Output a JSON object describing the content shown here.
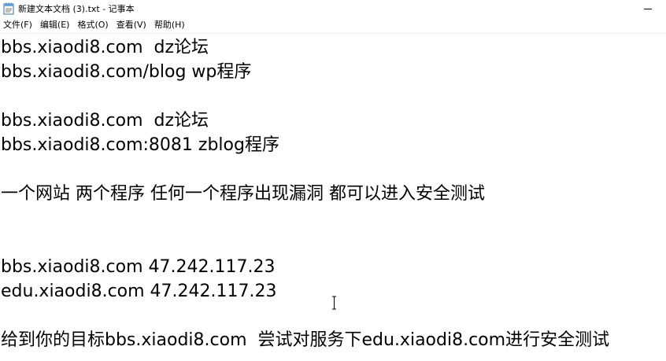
{
  "window": {
    "title": "新建文本文档 (3).txt - 记事本"
  },
  "menubar": {
    "items": [
      {
        "label": "文件(F)"
      },
      {
        "label": "编辑(E)"
      },
      {
        "label": "格式(O)"
      },
      {
        "label": "查看(V)"
      },
      {
        "label": "帮助(H)"
      }
    ]
  },
  "editor": {
    "lines": [
      "bbs.xiaodi8.com  dz论坛",
      "bbs.xiaodi8.com/blog wp程序",
      "",
      "bbs.xiaodi8.com  dz论坛",
      "bbs.xiaodi8.com:8081 zblog程序",
      "",
      "一个网站 两个程序 任何一个程序出现漏洞 都可以进入安全测试",
      "",
      "",
      "bbs.xiaodi8.com 47.242.117.23",
      "edu.xiaodi8.com 47.242.117.23",
      "",
      "给到你的目标bbs.xiaodi8.com  尝试对服务下edu.xiaodi8.com进行安全测试"
    ]
  },
  "icons": {
    "app": "notepad-icon",
    "minimize": "minimize-icon",
    "cursor": "text-cursor-icon"
  }
}
